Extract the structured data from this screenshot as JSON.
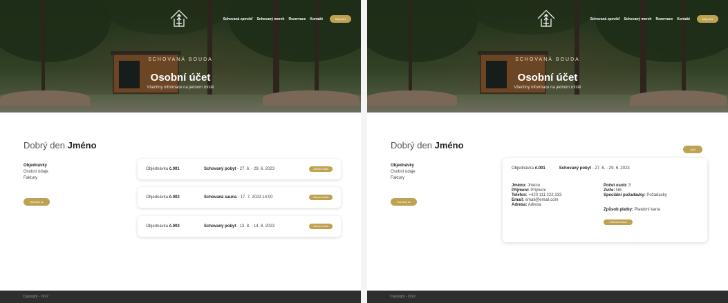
{
  "colors": {
    "accent": "#bfa152",
    "footer": "#2e2e2e"
  },
  "nav": {
    "links": [
      "Schovaná zpověď",
      "Schovaný merch",
      "Rezervace",
      "Kontakt"
    ],
    "cta": "Můj účet"
  },
  "icons": {
    "logo": "cabin-tree-logo-icon"
  },
  "hero": {
    "brand": "SCHOVANÁ BOUDA",
    "title": "Osobní účet",
    "subtitle": "Všechny informace na jednom místě"
  },
  "greeting": {
    "prefix": "Dobrý den",
    "name": "Jméno"
  },
  "sidebar": {
    "items": [
      "Objednávky",
      "Osobní údaje",
      "Faktury"
    ],
    "logout": "Odhlásit se"
  },
  "orders": [
    {
      "label": "Objednávka",
      "number": "č.001",
      "type": "Schovaný pobyt",
      "detail": "- 27. 6. - 29. 6. 2023",
      "button": "Zobrazit detail"
    },
    {
      "label": "Objednávka",
      "number": "č.002",
      "type": "Schovaná sauna",
      "detail": "- 17. 7. 2023 14:00",
      "button": "Zobrazit detail"
    },
    {
      "label": "Objednávka",
      "number": "č.003",
      "type": "Schovaný pobyt",
      "detail": "- 13. 8. - 14. 8. 2023",
      "button": "Zobrazit detail"
    }
  ],
  "detail": {
    "back": "Zpět",
    "order_label": "Objednávka",
    "order_number": "č.001",
    "type": "Schovaný pobyt",
    "dates": "- 27. 6. - 29. 6. 2023",
    "left": [
      {
        "k": "Jméno:",
        "v": "Jméno"
      },
      {
        "k": "Příjmení:",
        "v": "Příjmení"
      },
      {
        "k": "Telefon:",
        "v": "+420 111 222 333"
      },
      {
        "k": "Email:",
        "v": "email@email.com"
      },
      {
        "k": "Adresa:",
        "v": "Adresa"
      }
    ],
    "right": [
      {
        "k": "Počet osob:",
        "v": "3"
      },
      {
        "k": "Zvíře:",
        "v": "NE"
      },
      {
        "k": "Speciální požadavky:",
        "v": "Požadavky"
      }
    ],
    "payment_key": "Způsob platby:",
    "payment_val": "Platební karta",
    "cancel": "Odstranit fakturu"
  },
  "footer": {
    "copyright": "Copyright - 2022"
  }
}
